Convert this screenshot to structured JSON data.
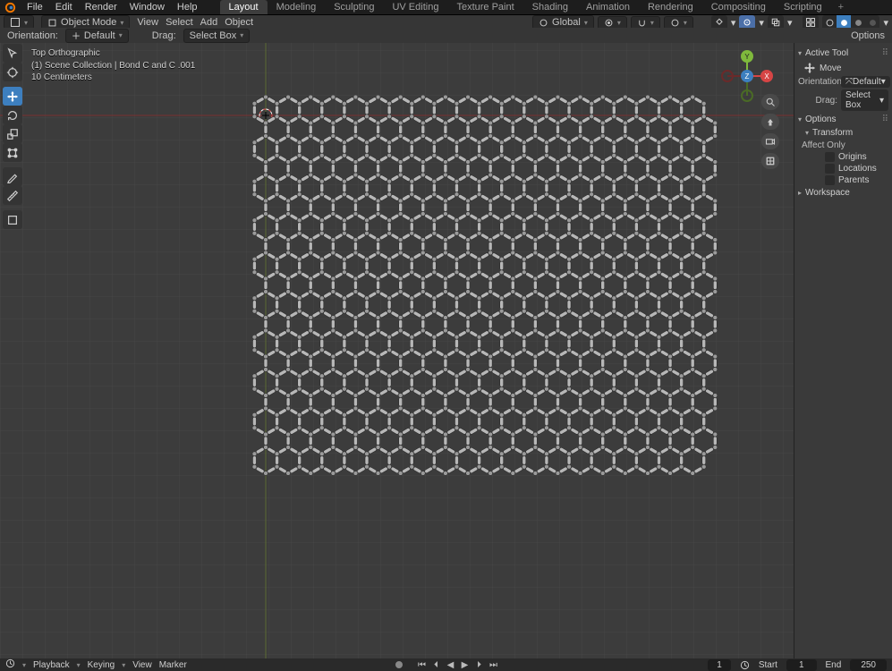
{
  "topbar": {
    "menus": [
      "File",
      "Edit",
      "Render",
      "Window",
      "Help"
    ],
    "tabs": [
      "Layout",
      "Modeling",
      "Sculpting",
      "UV Editing",
      "Texture Paint",
      "Shading",
      "Animation",
      "Rendering",
      "Compositing",
      "Scripting"
    ],
    "active_tab": "Layout"
  },
  "header": {
    "mode": "Object Mode",
    "menus": [
      "View",
      "Select",
      "Add",
      "Object"
    ],
    "orient": "Global",
    "options": "Options"
  },
  "header2": {
    "orientation_label": "Orientation:",
    "orientation": "Default",
    "drag_label": "Drag:",
    "drag": "Select Box"
  },
  "overlay": {
    "line1": "Top Orthographic",
    "line2": "(1) Scene Collection | Bond C  and C .001",
    "line3": "10 Centimeters"
  },
  "npanel": {
    "active_tool": "Active Tool",
    "tool_name": "Move",
    "orientation_label": "Orientation",
    "orientation": "Default",
    "drag_label": "Drag:",
    "drag": "Select Box",
    "options": "Options",
    "transform": "Transform",
    "affect_only": "Affect Only",
    "origins": "Origins",
    "locations": "Locations",
    "parents": "Parents",
    "workspace": "Workspace"
  },
  "gizmo": {
    "y": "Y",
    "x": "X",
    "z": "Z"
  },
  "timeline": {
    "playback": "Playback",
    "keying": "Keying",
    "view": "View",
    "marker": "Marker",
    "frame": 1,
    "start_label": "Start",
    "start": 1,
    "end_label": "End",
    "end": 250
  }
}
